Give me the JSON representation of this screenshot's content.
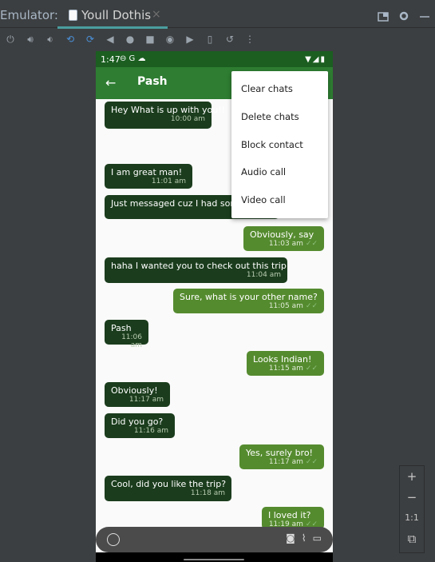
{
  "ide": {
    "panel_title": "Emulator:",
    "tab_label": "Youll Dothis",
    "tab_close": "×",
    "top_icons": [
      "layout-icon",
      "gear-icon",
      "minimize-icon"
    ],
    "toolbar_icons": [
      "power-icon",
      "volume-up-icon",
      "volume-down-icon",
      "rotate-left-icon",
      "rotate-right-icon",
      "back-icon",
      "home-icon",
      "overview-icon",
      "camera-icon",
      "video-icon",
      "fold-icon",
      "restore-icon",
      "more-icon"
    ]
  },
  "phone": {
    "status": {
      "time": "1:47",
      "icons": "⊖ G ☁"
    },
    "appbar": {
      "back": "←",
      "contact": "Pash"
    },
    "messages": [
      {
        "dir": "in",
        "text": "Hey What is up with you!!",
        "time": "10:00 am"
      },
      {
        "dir": "in",
        "text": "I am great man!",
        "time": "11:01 am"
      },
      {
        "dir": "in",
        "text": "Just messaged cuz I had som",
        "time": ""
      },
      {
        "dir": "out",
        "text": "Obviously, say",
        "time": "11:03 am"
      },
      {
        "dir": "in",
        "text": "haha I wanted you to check out this trip",
        "time": "11:04 am"
      },
      {
        "dir": "out",
        "text": "Sure, what is your other name?",
        "time": "11:05 am"
      },
      {
        "dir": "in",
        "text": "Pash",
        "time": "11:06 am"
      },
      {
        "dir": "out",
        "text": "Looks Indian!",
        "time": "11:15 am"
      },
      {
        "dir": "in",
        "text": "Obviously!",
        "time": "11:17 am"
      },
      {
        "dir": "in",
        "text": "Did you go?",
        "time": "11:16 am"
      },
      {
        "dir": "out",
        "text": "Yes, surely bro!",
        "time": "11:17 am"
      },
      {
        "dir": "in",
        "text": "Cool, did you like the trip?",
        "time": "11:18 am"
      },
      {
        "dir": "out",
        "text": "I loved it?",
        "time": "11:19 am"
      }
    ],
    "menu": [
      "Clear chats",
      "Delete chats",
      "Block contact",
      "Audio call",
      "Video call"
    ]
  },
  "zoom": {
    "plus": "+",
    "minus": "−",
    "ratio": "1:1"
  }
}
